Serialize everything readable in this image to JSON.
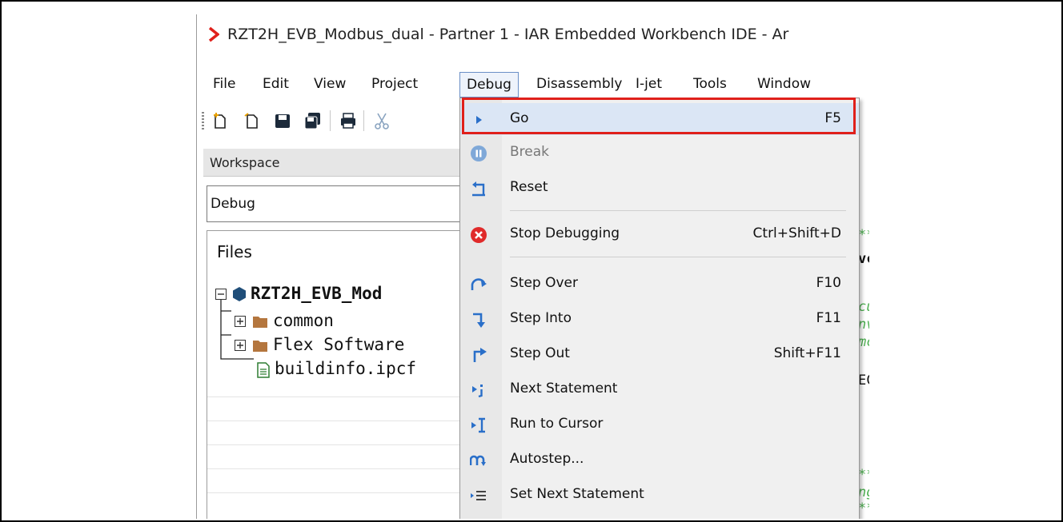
{
  "window": {
    "title": "RZT2H_EVB_Modbus_dual - Partner 1 - IAR Embedded Workbench IDE - Ar",
    "accent_color": "#e0201b"
  },
  "menubar": {
    "items": [
      {
        "label": "File"
      },
      {
        "label": "Edit"
      },
      {
        "label": "View"
      },
      {
        "label": "Project"
      },
      {
        "label": "Debug",
        "active": true
      },
      {
        "label": "Disassembly"
      },
      {
        "label": "I-jet"
      },
      {
        "label": "Tools"
      },
      {
        "label": "Window"
      }
    ]
  },
  "toolbar": {
    "icons": [
      "new-file-icon",
      "open-file-icon",
      "save-icon",
      "save-all-icon",
      "print-icon",
      "cut-icon"
    ]
  },
  "workspace": {
    "title": "Workspace",
    "configuration": "Debug",
    "files_header": "Files",
    "tree": [
      {
        "label": "RZT2H_EVB_Mod",
        "bold": true,
        "type": "project"
      },
      {
        "label": "common",
        "type": "folder"
      },
      {
        "label": "Flex Software",
        "type": "folder"
      },
      {
        "label": "buildinfo.ipcf",
        "type": "file"
      }
    ]
  },
  "debug_menu": {
    "items": [
      {
        "label": "Go",
        "shortcut": "F5",
        "icon": "go-icon",
        "highlighted": true
      },
      {
        "label": "Break",
        "shortcut": "",
        "icon": "break-icon",
        "disabled": true
      },
      {
        "label": "Reset",
        "shortcut": "",
        "icon": "reset-icon"
      },
      {
        "label": "Stop Debugging",
        "shortcut": "Ctrl+Shift+D",
        "icon": "stop-debugging-icon"
      },
      {
        "label": "Step Over",
        "shortcut": "F10",
        "icon": "step-over-icon"
      },
      {
        "label": "Step Into",
        "shortcut": "F11",
        "icon": "step-into-icon"
      },
      {
        "label": "Step Out",
        "shortcut": "Shift+F11",
        "icon": "step-out-icon"
      },
      {
        "label": "Next Statement",
        "shortcut": "",
        "icon": "next-statement-icon"
      },
      {
        "label": "Run to Cursor",
        "shortcut": "",
        "icon": "run-to-cursor-icon"
      },
      {
        "label": "Autostep...",
        "shortcut": "",
        "icon": "autostep-icon"
      },
      {
        "label": "Set Next Statement",
        "shortcut": "",
        "icon": "set-next-statement-icon"
      }
    ]
  },
  "editor": {
    "fragments": [
      "**",
      "vc",
      "cu",
      "nv",
      "mc",
      "EC",
      "**",
      "ng",
      "**"
    ]
  }
}
